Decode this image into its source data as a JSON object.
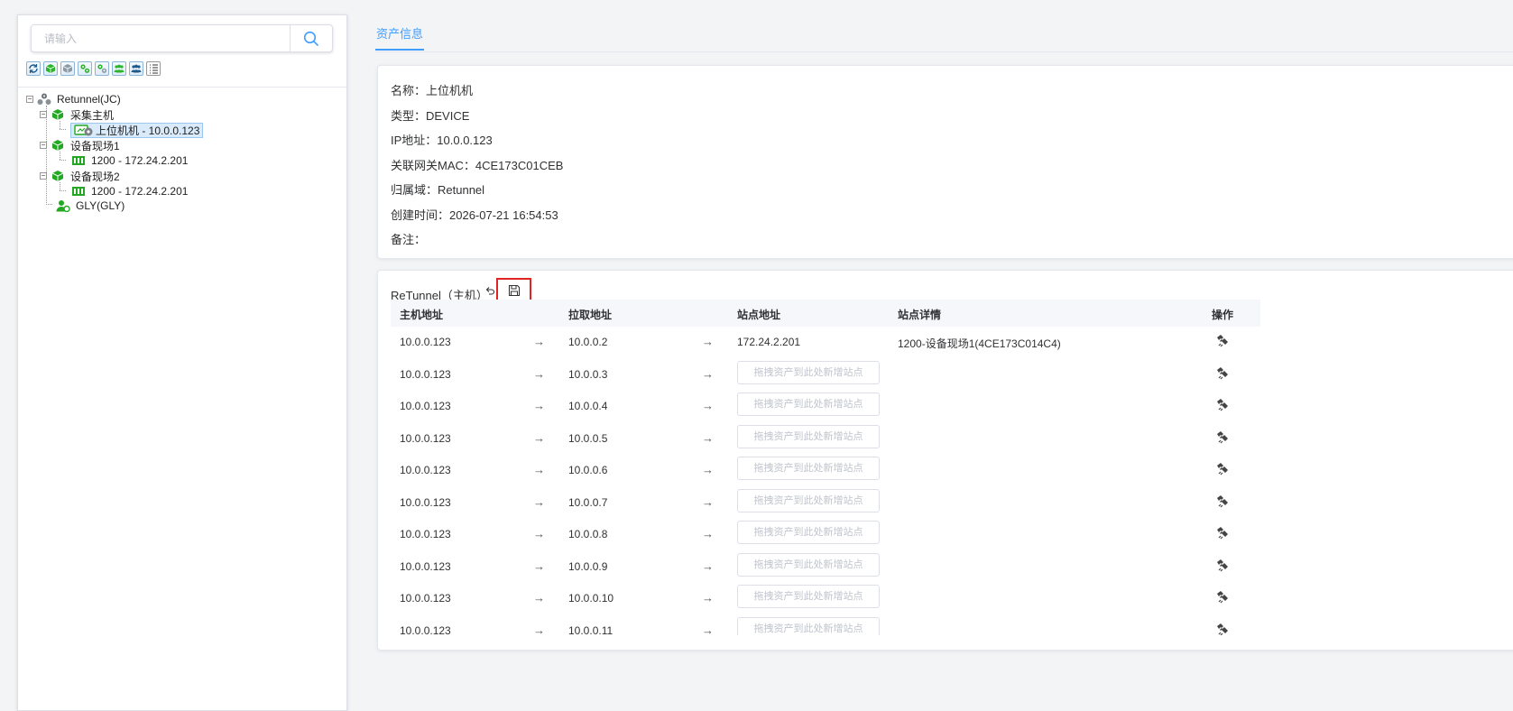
{
  "sidebar": {
    "search": {
      "placeholder": "请输入",
      "value": ""
    },
    "toolbar": [
      {
        "icon": "refresh-icon"
      },
      {
        "icon": "cube-green-icon"
      },
      {
        "icon": "cube-gray-icon"
      },
      {
        "icon": "gears-green-icon"
      },
      {
        "icon": "gears-gray-icon"
      },
      {
        "icon": "users-green-icon"
      },
      {
        "icon": "users-gray-icon"
      },
      {
        "icon": "list-icon"
      }
    ],
    "tree": {
      "root": "Retunnel(JC)",
      "collect_host": "采集主机",
      "host_pc": "上位机机 - 10.0.0.123",
      "site1": "设备现场1",
      "site1_plc": "1200 - 172.24.2.201",
      "site2": "设备现场2",
      "site2_plc": "1200 - 172.24.2.201",
      "admin": "GLY(GLY)"
    }
  },
  "tabs": {
    "asset_info": "资产信息"
  },
  "info": {
    "name": "名称：上位机机",
    "type": "类型：DEVICE",
    "ip": "IP地址：10.0.0.123",
    "mac": "关联网关MAC：4CE173C01CEB",
    "domain": "归属域：Retunnel",
    "created": "创建时间：2026-07-21 16:54:53",
    "note": "备注："
  },
  "tunnel": {
    "title": "ReTunnel（主机）",
    "columns": {
      "host": "主机地址",
      "pull": "拉取地址",
      "site": "站点地址",
      "detail": "站点详情",
      "op": "操作"
    },
    "placeholder": "拖拽资产到此处新增站点",
    "rows": [
      {
        "host": "10.0.0.123",
        "pull": "10.0.0.2",
        "site": "172.24.2.201",
        "detail": "1200-设备现场1(4CE173C014C4)"
      },
      {
        "host": "10.0.0.123",
        "pull": "10.0.0.3",
        "site": "",
        "detail": ""
      },
      {
        "host": "10.0.0.123",
        "pull": "10.0.0.4",
        "site": "",
        "detail": ""
      },
      {
        "host": "10.0.0.123",
        "pull": "10.0.0.5",
        "site": "",
        "detail": ""
      },
      {
        "host": "10.0.0.123",
        "pull": "10.0.0.6",
        "site": "",
        "detail": ""
      },
      {
        "host": "10.0.0.123",
        "pull": "10.0.0.7",
        "site": "",
        "detail": ""
      },
      {
        "host": "10.0.0.123",
        "pull": "10.0.0.8",
        "site": "",
        "detail": ""
      },
      {
        "host": "10.0.0.123",
        "pull": "10.0.0.9",
        "site": "",
        "detail": ""
      },
      {
        "host": "10.0.0.123",
        "pull": "10.0.0.10",
        "site": "",
        "detail": ""
      },
      {
        "host": "10.0.0.123",
        "pull": "10.0.0.11",
        "site": "",
        "detail": ""
      }
    ]
  },
  "colors": {
    "accent": "#409eff",
    "highlight": "#e02424",
    "tree_green": "#22a822"
  }
}
